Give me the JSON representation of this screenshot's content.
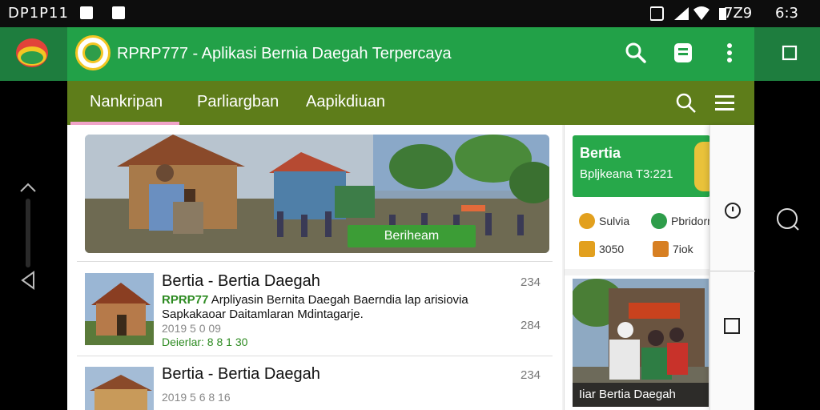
{
  "status_bar": {
    "left_text": "DP1P11",
    "right_text": "7Z9",
    "far_right_text": "6:3"
  },
  "app": {
    "title": "RPRP777 - Aplikasi Bernia Daegah Terpercaya"
  },
  "nav": {
    "tabs": [
      {
        "label": "Nankripan"
      },
      {
        "label": "Parliargban"
      },
      {
        "label": "Aapikdiuan"
      }
    ]
  },
  "hero": {
    "button_label": "Beriheam"
  },
  "news": [
    {
      "title": "Bertia - Bertia Daegah",
      "sub_highlight": "RPRP77",
      "sub_text": " Arpliyasin Bernita Daegah Baerndia lap arisiovia",
      "sub_text_2": "Sapkakaoar Daitamlaran Mdintagarje.",
      "meta": "2019 5 0 09",
      "source": "Deierlar: 8 8 1 30",
      "count_top": "234",
      "count_bottom": "284"
    },
    {
      "title": "Bertia - Bertia Daegah",
      "meta": "2019 5 6 8 16",
      "count_top": "234"
    }
  ],
  "side": {
    "feature_title": "Bertia",
    "feature_sub": "Bpljkeana T3:221",
    "stats": [
      {
        "label": "Sulvia",
        "color": "#e2a01e"
      },
      {
        "label": "Pbridorn",
        "color": "#2e9d4a"
      },
      {
        "label": "3050",
        "color": "#e2a01e"
      },
      {
        "label": "7iok",
        "color": "#d77f22"
      }
    ],
    "caption": "Iiar Bertia Daegah"
  },
  "colors": {
    "appbar": "#22a148",
    "navbar": "#5e7d1a",
    "accent": "#f0a3c8"
  }
}
